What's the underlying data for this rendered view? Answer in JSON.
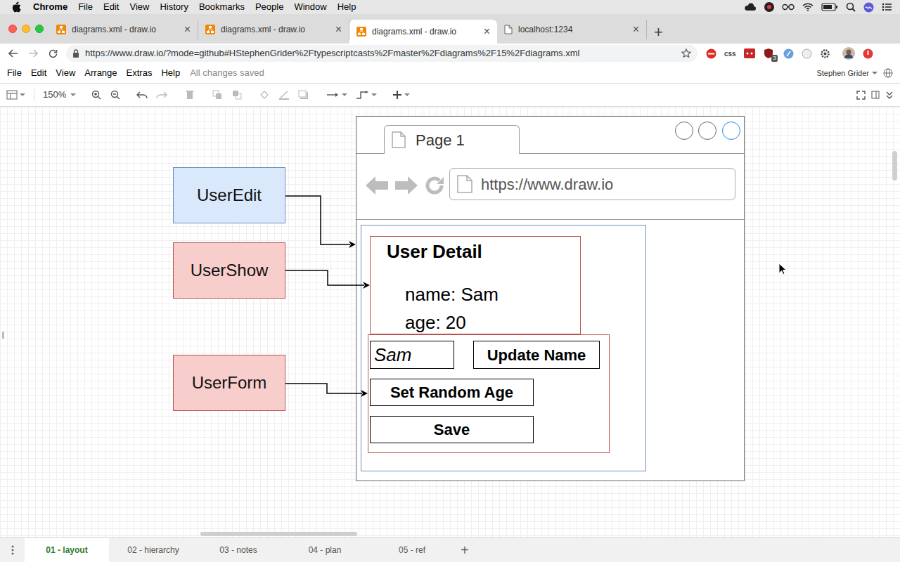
{
  "menubar": {
    "app": "Chrome",
    "items": [
      "File",
      "Edit",
      "View",
      "History",
      "Bookmarks",
      "People",
      "Window",
      "Help"
    ]
  },
  "browser": {
    "tabs": [
      {
        "label": "diagrams.xml - draw.io",
        "selected": false
      },
      {
        "label": "diagrams.xml - draw.io",
        "selected": false
      },
      {
        "label": "diagrams.xml - draw.io",
        "selected": true
      },
      {
        "label": "localhost:1234",
        "selected": false
      }
    ],
    "close": "×",
    "new_tab": "+",
    "url": "https://www.draw.io/?mode=github#HStephenGrider%2Ftypescriptcasts%2Fmaster%2Fdiagrams%2F15%2Fdiagrams.xml",
    "extension_label": "css",
    "extension_badge": "3"
  },
  "app": {
    "menu": [
      "File",
      "Edit",
      "View",
      "Arrange",
      "Extras",
      "Help"
    ],
    "status": "All changes saved",
    "user": "Stephen Grider",
    "zoom": "150%"
  },
  "diagram": {
    "components": [
      {
        "label": "UserEdit",
        "color": "#dae8fc"
      },
      {
        "label": "UserShow",
        "color": "#f8cecc"
      },
      {
        "label": "UserForm",
        "color": "#f8cecc"
      }
    ],
    "mock_tab": "Page 1",
    "mock_url": "https://www.draw.io",
    "detail": {
      "title": "User Detail",
      "fields": [
        "name: Sam",
        "age: 20"
      ]
    },
    "form": {
      "input": "Sam",
      "buttons": [
        "Update Name",
        "Set Random Age",
        "Save"
      ]
    }
  },
  "pages": [
    {
      "label": "01 - layout",
      "selected": true
    },
    {
      "label": "02 - hierarchy",
      "selected": false
    },
    {
      "label": "03 - notes",
      "selected": false
    },
    {
      "label": "04 - plan",
      "selected": false
    },
    {
      "label": "05 - ref",
      "selected": false
    }
  ],
  "add_page": "+"
}
